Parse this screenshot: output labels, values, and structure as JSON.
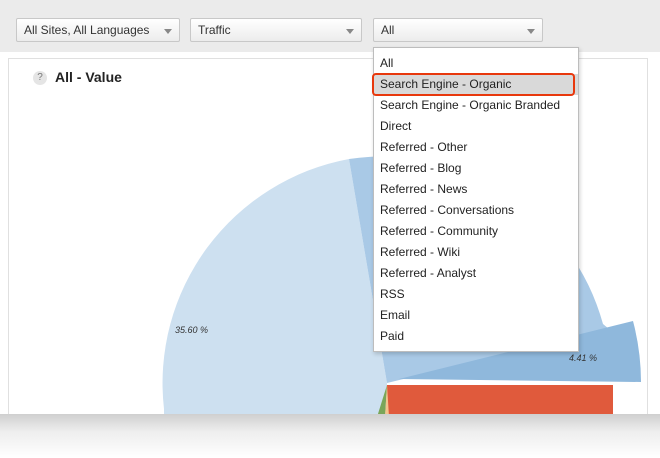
{
  "filters": {
    "site_select": "All Sites, All Languages",
    "metric_select": "Traffic",
    "source_select": "All"
  },
  "panel": {
    "title": "All - Value",
    "help_glyph": "?"
  },
  "chart_data": {
    "type": "pie",
    "title": "All - Value",
    "labels_shown": [
      "35.60 %",
      "4.41 %"
    ],
    "slices": [
      {
        "value": 35.6,
        "label": "35.60 %",
        "color": "#cde0f0"
      },
      {
        "value": 4.41,
        "label": "4.41 %",
        "color": "#8fb8dc"
      }
    ]
  },
  "dropdown": {
    "items": [
      "All",
      "Search Engine - Organic",
      "Search Engine - Organic Branded",
      "Direct",
      "Referred - Other",
      "Referred - Blog",
      "Referred - News",
      "Referred - Conversations",
      "Referred - Community",
      "Referred - Wiki",
      "Referred - Analyst",
      "RSS",
      "Email",
      "Paid"
    ],
    "highlighted_index": 1
  },
  "colors": {
    "highlight_ring": "#e8380d",
    "pie_light_blue": "#cde0f0",
    "pie_mid_blue": "#8fb8dc",
    "pie_red": "#e05a3c",
    "pie_green": "#7aa65a"
  }
}
